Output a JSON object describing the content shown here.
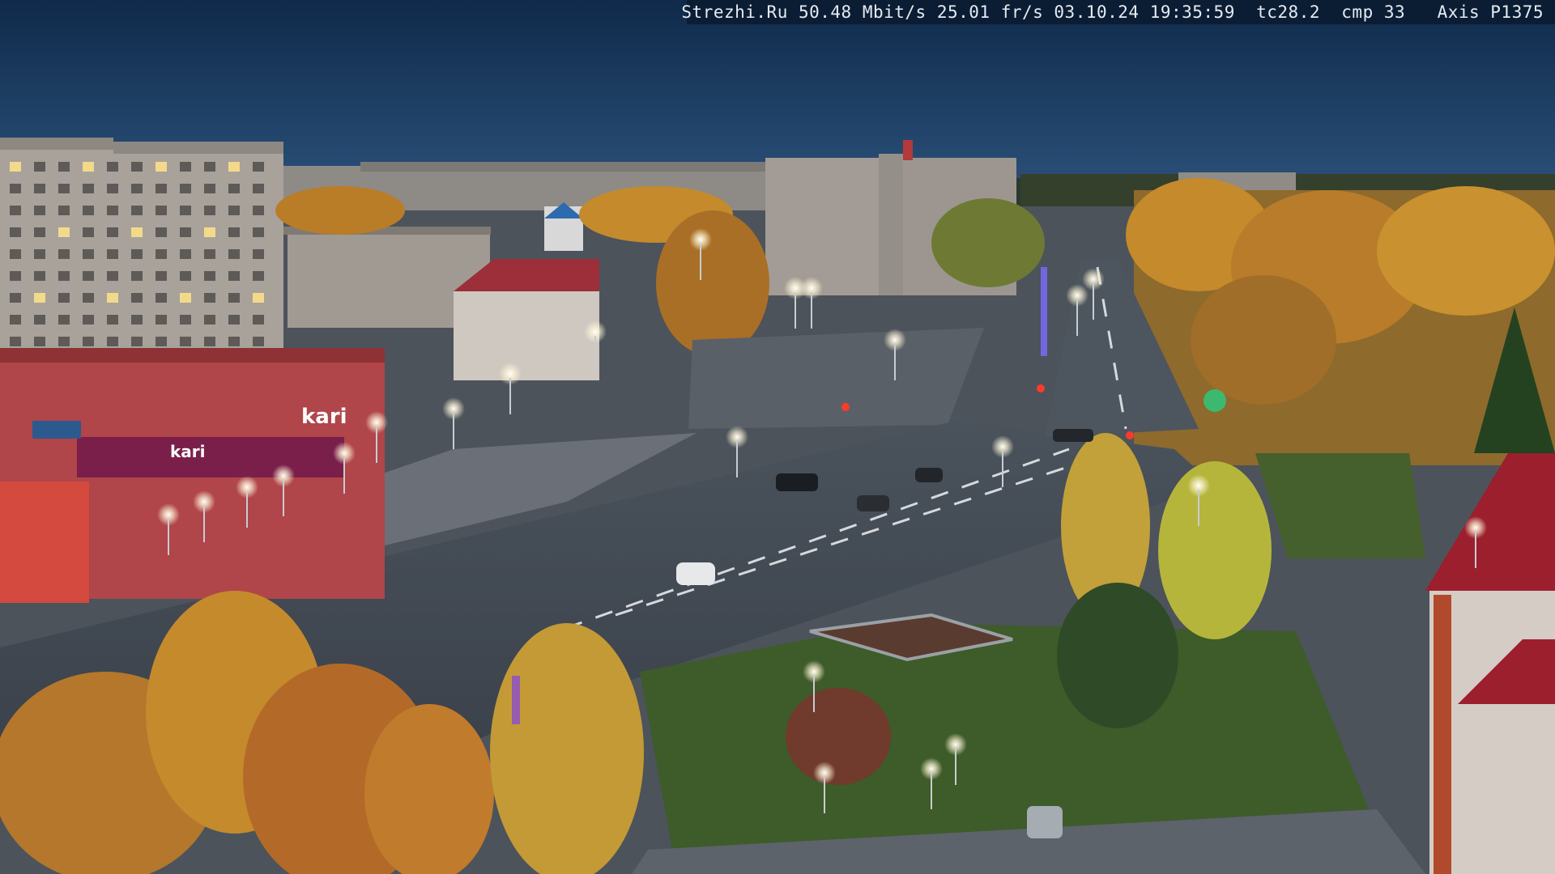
{
  "overlay": {
    "text": "Strezhi.Ru 50.48 Mbit/s 25.01 fr/s 03.10.24 19:35:59  tc28.2  cmp 33   Axis P1375"
  },
  "signage": {
    "store_logo": "kari",
    "store_banner": "kari"
  },
  "colors": {
    "sky_top": "#0f2a4a",
    "sky_horizon": "#2a4f78",
    "asphalt": "#3f4650",
    "grass": "#3e5b2a",
    "autumn_foliage": "#c0862a",
    "store_facade": "#b0454a",
    "brick_red": "#9c2f3a",
    "overlay_bg": "#0b1d33",
    "overlay_text": "#eef3f8"
  }
}
